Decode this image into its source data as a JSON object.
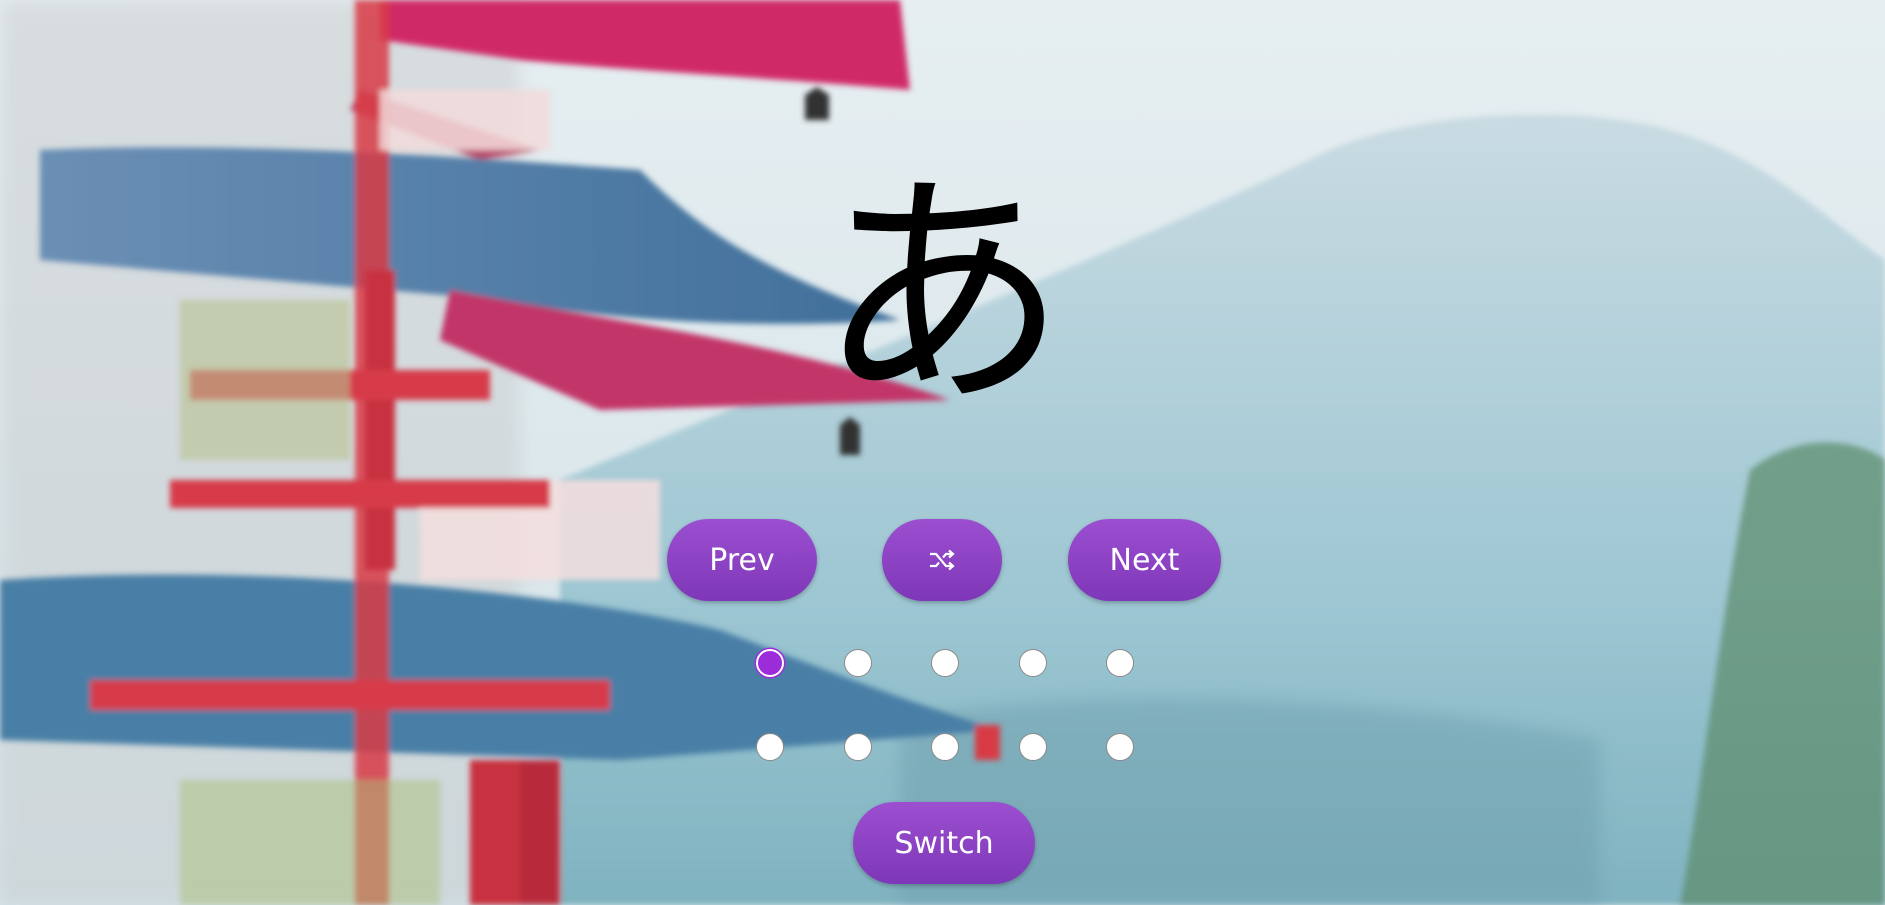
{
  "flashcard": {
    "character": "あ"
  },
  "controls": {
    "prev_label": "Prev",
    "shuffle_icon": "shuffle-icon",
    "next_label": "Next",
    "switch_label": "Switch"
  },
  "pagination": {
    "rows": 2,
    "per_row": 5,
    "active_index": 0
  },
  "colors": {
    "button": "#8a3fc4",
    "active_dot": "#9c2bd9"
  }
}
